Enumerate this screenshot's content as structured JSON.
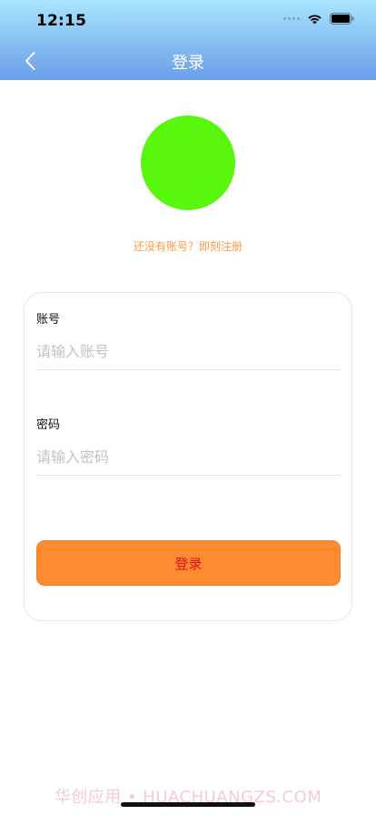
{
  "status_bar": {
    "time": "12:15",
    "icons": [
      "signal-dots-icon",
      "wifi-icon",
      "battery-icon"
    ]
  },
  "nav": {
    "back_icon": "chevron-left-icon",
    "title": "登录"
  },
  "logo": {
    "color": "#5af70e"
  },
  "register_link": "还没有账号？即刻注册",
  "form": {
    "account": {
      "label": "账号",
      "placeholder": "请输入账号",
      "value": ""
    },
    "password": {
      "label": "密码",
      "placeholder": "请输入密码",
      "value": ""
    },
    "submit_label": "登录"
  },
  "watermark": "华创应用 • HUACHUANGZS.COM",
  "colors": {
    "header_top": "#a9e5ff",
    "header_bottom": "#6b9ee9",
    "accent_orange": "#ff8b30",
    "link_orange": "#ff9a44",
    "button_text": "#e0101b"
  }
}
